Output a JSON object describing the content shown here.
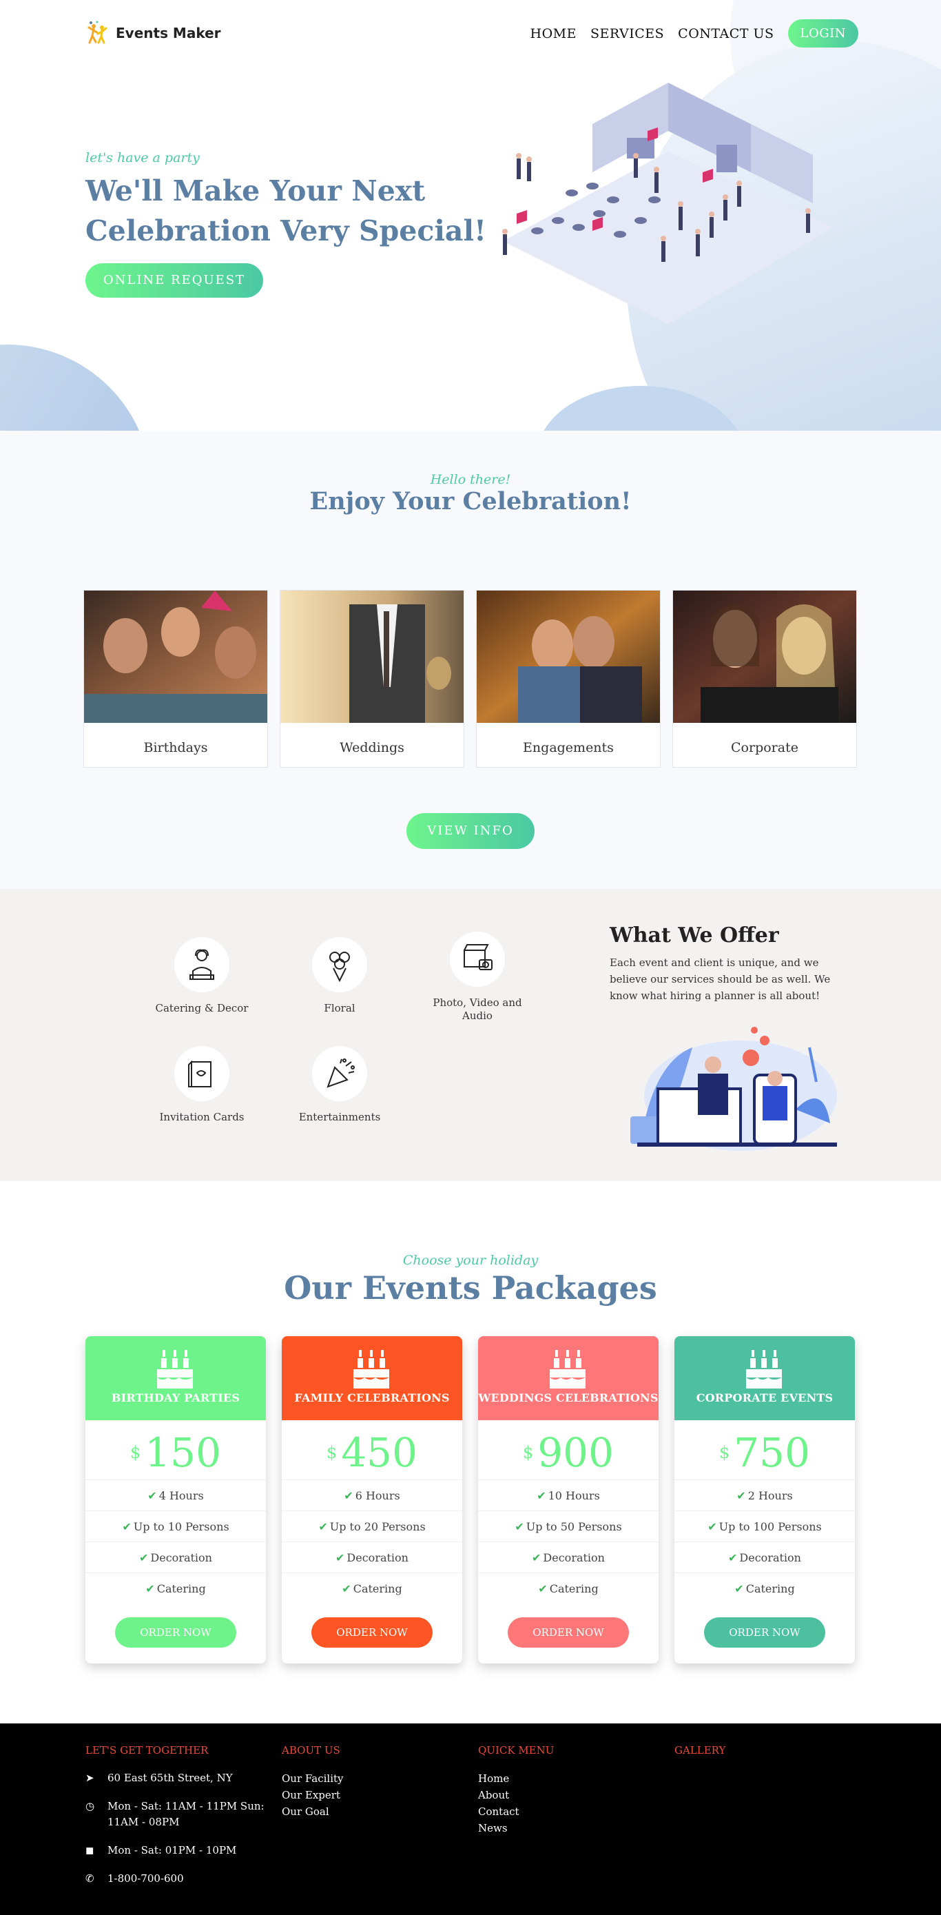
{
  "header": {
    "logo_text": "Events Maker",
    "nav": [
      "HOME",
      "SERVICES",
      "CONTACT US"
    ],
    "login": "LOGIN"
  },
  "hero": {
    "kicker": "let's have a party",
    "title_line1": "We'll Make Your Next",
    "title_line2": "Celebration Very Special!",
    "button": "ONLINE REQUEST"
  },
  "enjoy": {
    "kicker": "Hello there!",
    "title": "Enjoy Your Celebration!",
    "cards": [
      {
        "label": "Birthdays"
      },
      {
        "label": "Weddings"
      },
      {
        "label": "Engagements"
      },
      {
        "label": "Corporate"
      }
    ],
    "button": "VIEW INFO"
  },
  "offer": {
    "services": [
      {
        "label": "Catering & Decor",
        "icon": "chef-icon"
      },
      {
        "label": "Floral",
        "icon": "flower-bouquet-icon"
      },
      {
        "label": "Photo, Video and Audio",
        "icon": "camera-clapper-icon"
      },
      {
        "label": "Invitation Cards",
        "icon": "invitation-card-icon"
      },
      {
        "label": "Entertainments",
        "icon": "party-popper-icon"
      }
    ],
    "title": "What We Offer",
    "description": "Each event and client is unique, and we believe our services should be as well. We know what hiring a planner is all about!"
  },
  "packages": {
    "kicker": "Choose your holiday",
    "title": "Our Events Packages",
    "currency": "$",
    "check_icon": "check-icon",
    "items": [
      {
        "name": "BIRTHDAY PARTIES",
        "price": "150",
        "color": "#6ef28a",
        "features": [
          "4 Hours",
          "Up to 10 Persons",
          "Decoration",
          "Catering"
        ],
        "button": "ORDER NOW"
      },
      {
        "name": "FAMILY CELEBRATIONS",
        "price": "450",
        "color": "#fd5523",
        "features": [
          "6 Hours",
          "Up to 20 Persons",
          "Decoration",
          "Catering"
        ],
        "button": "ORDER NOW"
      },
      {
        "name": "WEDDINGS CELEBRATIONS",
        "price": "900",
        "color": "#fd7678",
        "features": [
          "10 Hours",
          "Up to 50 Persons",
          "Decoration",
          "Catering"
        ],
        "button": "ORDER NOW"
      },
      {
        "name": "CORPORATE EVENTS",
        "price": "750",
        "color": "#4dc0a0",
        "features": [
          "2 Hours",
          "Up to 100 Persons",
          "Decoration",
          "Catering"
        ],
        "button": "ORDER NOW"
      }
    ],
    "price_color": "#6ef28a"
  },
  "footer": {
    "col1_title": "LET'S GET TOGETHER",
    "contacts": [
      {
        "icon": "location-arrow-icon",
        "text": "60 East 65th Street, NY"
      },
      {
        "icon": "clock-icon",
        "text": "Mon - Sat: 11AM - 11PM Sun: 11AM - 08PM"
      },
      {
        "icon": "shopping-bag-icon",
        "text": "Mon - Sat: 01PM - 10PM"
      },
      {
        "icon": "phone-icon",
        "text": "1-800-700-600"
      }
    ],
    "col2_title": "ABOUT US",
    "about_links": [
      "Our Facility",
      "Our Expert",
      "Our Goal"
    ],
    "col3_title": "QUICK MENU",
    "menu_links": [
      "Home",
      "About",
      "Contact",
      "News"
    ],
    "col4_title": "GALLERY",
    "accent": "#e94a3c"
  }
}
